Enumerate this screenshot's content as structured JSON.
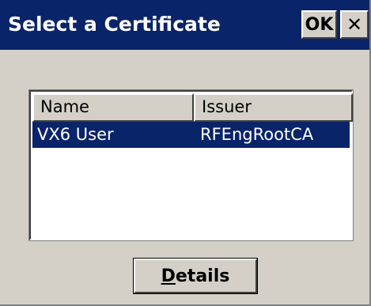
{
  "window": {
    "title": "Select a Certificate",
    "ok_label": "OK",
    "close_label": "✕"
  },
  "list": {
    "columns": [
      "Name",
      "Issuer"
    ],
    "rows": [
      {
        "name": "VX6 User",
        "issuer": "RFEngRootCA",
        "selected": true
      }
    ]
  },
  "buttons": {
    "details_mnemonic": "D",
    "details_rest": "etails"
  },
  "colors": {
    "titlebar": "#0a246a",
    "selection": "#0a246a",
    "face": "#d4d0c8"
  }
}
